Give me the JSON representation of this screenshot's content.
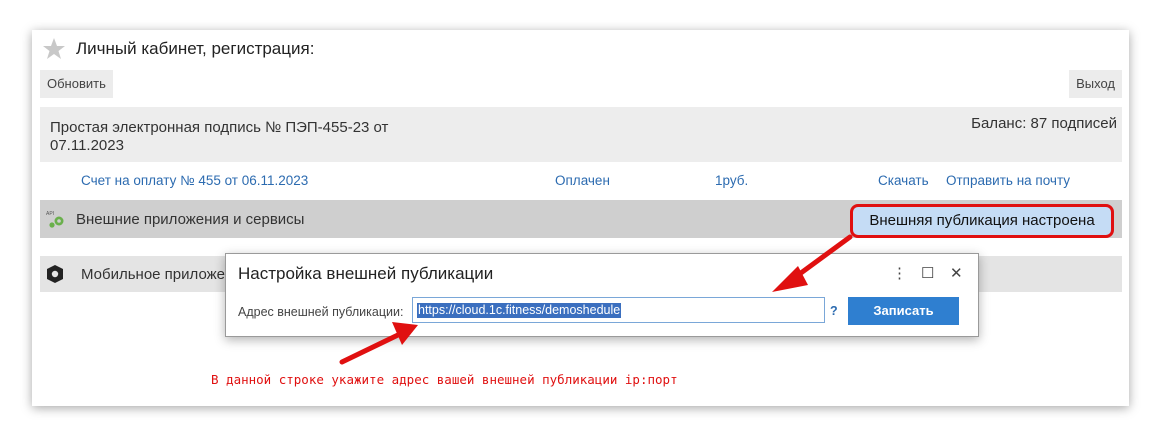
{
  "header": {
    "title": "Личный кабинет, регистрация:",
    "refresh_label": "Обновить",
    "exit_label": "Выход"
  },
  "signature": {
    "text": "Простая электронная подпись № ПЭП-455-23 от 07.11.2023",
    "balance": "Баланс: 87 подписей"
  },
  "invoice": {
    "title": "Счет на оплату № 455 от 06.11.2023",
    "status": "Оплачен",
    "amount": "1руб.",
    "download": "Скачать",
    "send_mail": "Отправить на почту"
  },
  "external": {
    "label": "Внешние приложения и сервисы",
    "badge": "Внешняя публикация настроена"
  },
  "mobile": {
    "label": "Мобильное приложе"
  },
  "dialog": {
    "title": "Настройка внешней публикации",
    "field_label": "Адрес внешней публикации:",
    "field_value": "https://cloud.1c.fitness/demoshedule",
    "help": "?",
    "save_label": "Записать",
    "more_icon": "⋮",
    "maximize_icon": "☐",
    "close_icon": "✕"
  },
  "annotation": {
    "hint": "В данной строке укажите адрес вашей внешней публикации ip:порт",
    "accent": "#e01010"
  }
}
